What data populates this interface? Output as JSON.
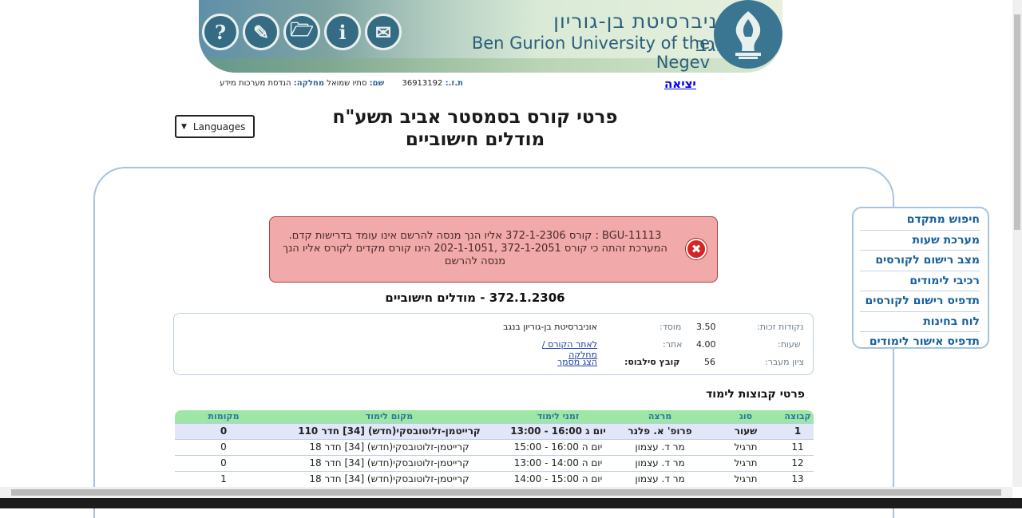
{
  "banner": {
    "university_hebrew": "אוניברסיטת בן-גוריון בנגב",
    "university_english": "Ben Gurion University of the Negev",
    "icons": [
      {
        "name": "help-icon",
        "glyph": "?"
      },
      {
        "name": "edit-icon",
        "glyph": "✎"
      },
      {
        "name": "folder-icon",
        "glyph": "🗁"
      },
      {
        "name": "info-icon",
        "glyph": "i"
      },
      {
        "name": "mail-icon",
        "glyph": "✉"
      }
    ]
  },
  "user": {
    "id_label": "ת.ז.:",
    "id_value": "36913192",
    "name_label": "שם:",
    "name_value": "סתיו שמואל",
    "dept_label": "מחלקה:",
    "dept_value": "הנדסת מערכות מידע"
  },
  "exit_link": "יציאה",
  "languages": {
    "label": "Languages",
    "arrow": "▼"
  },
  "title_line1": "פרטי קורס בסמסטר אביב תשע\"ח",
  "title_line2": "מודלים חישוביים",
  "side_menu": [
    "חיפוש מתקדם",
    "מערכת שעות",
    "מצב רישום לקורסים",
    "רכיבי לימודים",
    "תדפיס רישום לקורסים",
    "לוח בחינות",
    "תדפיס אישור לימודים"
  ],
  "error": {
    "line1": "BGU-11113 : קורס 372-1-2306 אליו הנך מנסה להרשם אינו עומד בדרישות קדם.",
    "line2": "המערכת זהתה כי קורס 372-1-2051 ,202-1-1051 הינו קורס מקדים לקורס אליו הנך מנסה להרשם",
    "icon": "✖"
  },
  "course_heading": "372.1.2306 - מודלים חישוביים",
  "course_info": {
    "credits_label": "נקודות זכות:",
    "credits_value": "3.50",
    "hours_label": "שעות:",
    "hours_value": "4.00",
    "pass_grade_label": "ציון מעבר:",
    "pass_grade_value": "56",
    "institution_label": "מוסד:",
    "institution_value": "אוניברסיטת בן-גוריון בנגב",
    "site_label": "אתר:",
    "site_value": "לאתר הקורס / מחלקה",
    "syllabus_label": "קובץ סילבוס:",
    "syllabus_value": "הצג מסמך"
  },
  "groups": {
    "title": "פרטי קבוצות לימוד",
    "columns": [
      "קבוצה",
      "סוג",
      "מרצה",
      "זמני לימוד",
      "מקום לימוד",
      "מקומות"
    ],
    "rows": [
      [
        "1",
        "שעור",
        "פרופ' א. פלנר",
        "יום ג 16:00 - 13:00",
        "קרייטמן-זלוטובסקי(חדש) [34] חדר 110",
        "0"
      ],
      [
        "11",
        "תרגיל",
        "מר ד. עצמון",
        "יום ה 16:00 - 15:00",
        "קרייטמן-זלוטובסקי(חדש) [34] חדר 18",
        "0"
      ],
      [
        "12",
        "תרגיל",
        "מר ד. עצמון",
        "יום ה 14:00 - 13:00",
        "קרייטמן-זלוטובסקי(חדש) [34] חדר 18",
        "0"
      ],
      [
        "13",
        "תרגיל",
        "מר ד. עצמון",
        "יום ה 15:00 - 14:00",
        "קרייטמן-זלוטובסקי(חדש) [34] חדר 18",
        "1"
      ]
    ]
  }
}
